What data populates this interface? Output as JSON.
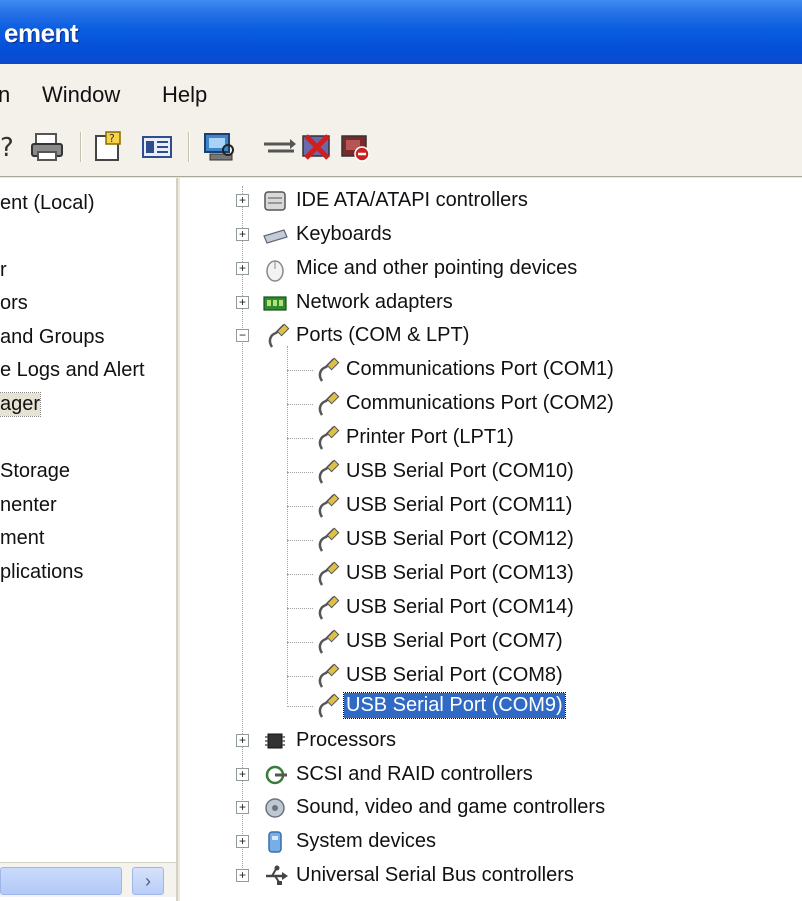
{
  "window": {
    "title": "ement"
  },
  "menubar": {
    "items": [
      "n",
      "Window",
      "Help"
    ]
  },
  "toolbar": {
    "icons": [
      "help-icon",
      "print-icon",
      "properties-icon",
      "view-icon",
      "scan-hardware-icon",
      "update-driver-icon",
      "uninstall-icon",
      "disable-icon"
    ]
  },
  "left_pane": {
    "items": [
      {
        "label": "ent (Local)"
      },
      {
        "label": ""
      },
      {
        "label": "r"
      },
      {
        "label": "ors"
      },
      {
        "label": "and Groups"
      },
      {
        "label": "e Logs and Alert"
      },
      {
        "label": "ager",
        "selected": true
      },
      {
        "label": ""
      },
      {
        "label": "Storage"
      },
      {
        "label": "nenter"
      },
      {
        "label": "ment"
      },
      {
        "label": "plications"
      }
    ],
    "scroll_arrow": "›"
  },
  "tree": {
    "expander_plus": "+",
    "expander_minus": "−",
    "categories": [
      {
        "label": "IDE ATA/ATAPI controllers",
        "icon": "ide-controller-icon",
        "expanded": false
      },
      {
        "label": "Keyboards",
        "icon": "keyboard-icon",
        "expanded": false
      },
      {
        "label": "Mice and other pointing devices",
        "icon": "mouse-icon",
        "expanded": false
      },
      {
        "label": "Network adapters",
        "icon": "network-adapter-icon",
        "expanded": false
      },
      {
        "label": "Ports (COM & LPT)",
        "icon": "port-icon",
        "expanded": true,
        "children": [
          {
            "label": "Communications Port (COM1)"
          },
          {
            "label": "Communications Port (COM2)"
          },
          {
            "label": "Printer Port (LPT1)"
          },
          {
            "label": "USB Serial Port (COM10)"
          },
          {
            "label": "USB Serial Port (COM11)"
          },
          {
            "label": "USB Serial Port (COM12)"
          },
          {
            "label": "USB Serial Port (COM13)"
          },
          {
            "label": "USB Serial Port (COM14)"
          },
          {
            "label": "USB Serial Port (COM7)"
          },
          {
            "label": "USB Serial Port (COM8)"
          },
          {
            "label": "USB Serial Port (COM9)",
            "selected": true
          }
        ]
      },
      {
        "label": "Processors",
        "icon": "processor-icon",
        "expanded": false
      },
      {
        "label": "SCSI and RAID controllers",
        "icon": "scsi-icon",
        "expanded": false
      },
      {
        "label": "Sound, video and game controllers",
        "icon": "sound-icon",
        "expanded": false
      },
      {
        "label": "System devices",
        "icon": "system-device-icon",
        "expanded": false
      },
      {
        "label": "Universal Serial Bus controllers",
        "icon": "usb-icon",
        "expanded": false
      }
    ]
  },
  "colors": {
    "titlebar": "#0a5ee0",
    "selection": "#316ac5",
    "chrome": "#ece9d8"
  }
}
